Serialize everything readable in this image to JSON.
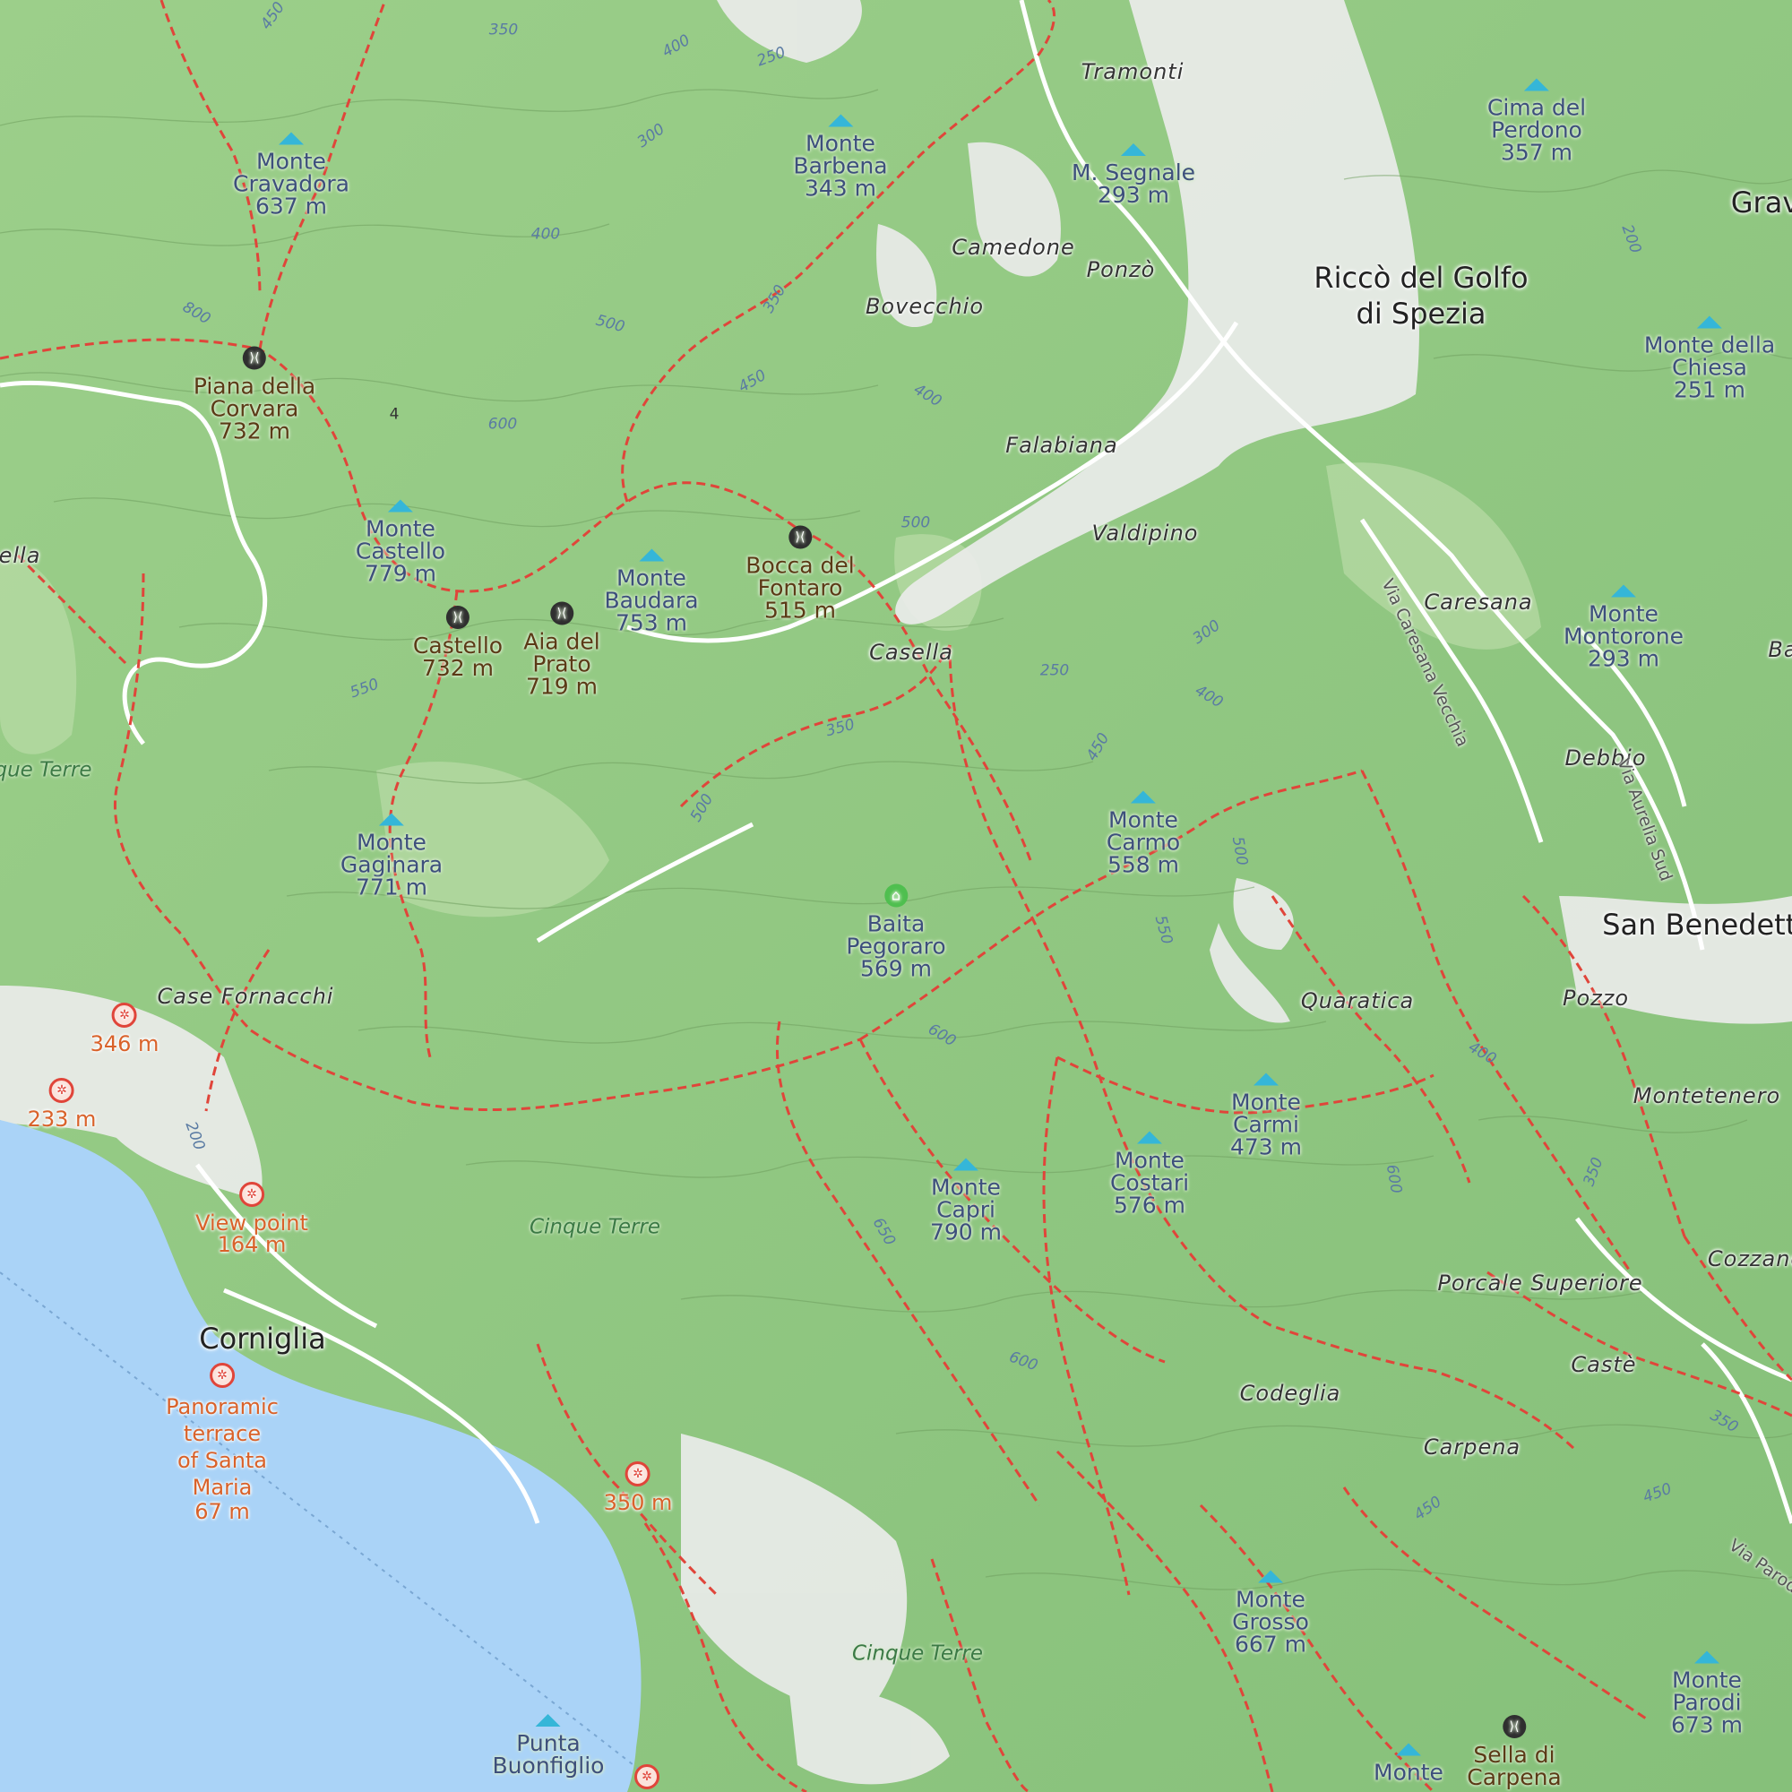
{
  "colors": {
    "forest": "#8fc87f",
    "sea": "#aad3f7",
    "trail": "#e0453a",
    "peak_icon": "#35b6d8",
    "urban": "#ececec"
  },
  "peaks": [
    {
      "name": "Monte\nCravadora",
      "elev": "637 m"
    },
    {
      "name": "Monte\nBarbena",
      "elev": "343 m"
    },
    {
      "name": "M. Segnale",
      "elev": "293 m"
    },
    {
      "name": "Cima del\nPerdono",
      "elev": "357 m"
    },
    {
      "name": "Monte della\nChiesa",
      "elev": "251 m"
    },
    {
      "name": "Monte\nCastello",
      "elev": "779 m"
    },
    {
      "name": "Monte\nBaudara",
      "elev": "753 m"
    },
    {
      "name": "Monte\nMontorone",
      "elev": "293 m"
    },
    {
      "name": "Monte\nGaginara",
      "elev": "771 m"
    },
    {
      "name": "Monte\nCarmo",
      "elev": "558 m"
    },
    {
      "name": "Monte\nCarmi",
      "elev": "473 m"
    },
    {
      "name": "Monte\nCostari",
      "elev": "576 m"
    },
    {
      "name": "Monte\nCapri",
      "elev": "790 m"
    },
    {
      "name": "Monte\nGrosso",
      "elev": "667 m"
    },
    {
      "name": "Monte\nParodi",
      "elev": "673 m"
    },
    {
      "name": "Punta\nBuonfiglio",
      "elev": ""
    },
    {
      "name": "Monte",
      "elev": ""
    }
  ],
  "passes": [
    {
      "name": "Piana della\nCorvara",
      "elev": "732 m"
    },
    {
      "name": "Castello",
      "elev": "732 m"
    },
    {
      "name": "Aia del\nPrato",
      "elev": "719 m"
    },
    {
      "name": "Bocca del\nFontaro",
      "elev": "515 m"
    },
    {
      "name": "Sella di\nCarpena",
      "elev": ""
    }
  ],
  "viewpoints": [
    {
      "name": "",
      "elev": "346 m"
    },
    {
      "name": "",
      "elev": "233 m"
    },
    {
      "name": "View point",
      "elev": "164 m"
    },
    {
      "name": "Panoramic\nterrace\nof Santa\nMaria",
      "elev": "67 m"
    },
    {
      "name": "",
      "elev": "350 m"
    }
  ],
  "huts": [
    {
      "name": "Baita\nPegoraro",
      "elev": "569 m"
    }
  ],
  "towns": [
    "Riccò del Golfo\ndi Spezia",
    "San Benedetto",
    "Corniglia",
    "Grav"
  ],
  "villages": [
    "Tramonti",
    "Camedone",
    "Ponzò",
    "Bovecchio",
    "Falabiana",
    "Valdipino",
    "Casella",
    "Caresana",
    "Debbio",
    "Case Fornacchi",
    "Quaratica",
    "Pozzo",
    "Montetenero",
    "Porcale\nSuperiore",
    "Castè",
    "Codeglia",
    "Carpena",
    "Cozzano",
    "ella",
    "Ba"
  ],
  "park_labels": [
    "Cinque Terre",
    "Cinque Terre",
    "Cinque Terre",
    "que Terre"
  ],
  "roads": [
    "Via Caresana Vecchia",
    "Via Aurelia Sud",
    "Via Parodi"
  ],
  "contour_labels": [
    "450",
    "350",
    "250",
    "400",
    "300",
    "200",
    "400",
    "500",
    "800",
    "350",
    "450",
    "400",
    "600",
    "500",
    "550",
    "300",
    "250",
    "400",
    "450",
    "500",
    "350",
    "500",
    "550",
    "600",
    "400",
    "350",
    "200",
    "650",
    "600",
    "600",
    "350",
    "450",
    "450",
    "4"
  ]
}
